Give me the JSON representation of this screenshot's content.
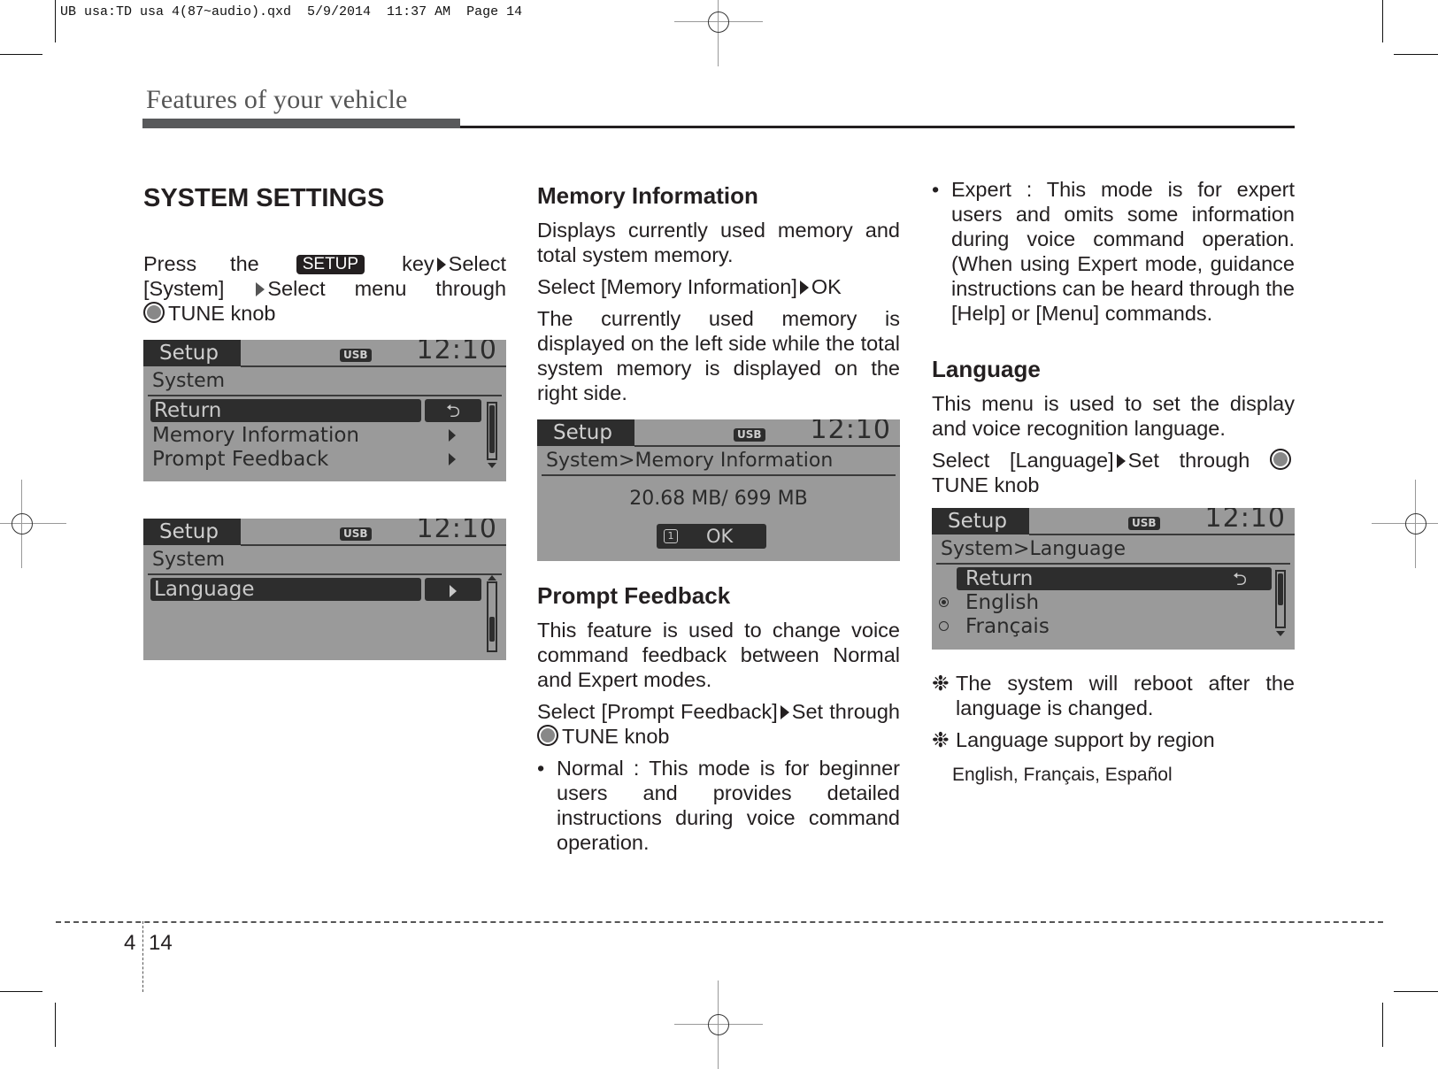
{
  "slug_line": "UB usa:TD usa 4(87~audio).qxd  5/9/2014  11:37 AM  Page 14",
  "running_head": "Features of your vehicle",
  "icons": {
    "arrow": "triangle-right-icon",
    "knob": "tune-knob-icon",
    "return": "return-arrow-icon",
    "note": "asterisk-note-icon"
  },
  "section1": {
    "title": "SYSTEM SETTINGS",
    "intro": {
      "t1": "Press the",
      "key": "SETUP",
      "t2": "key",
      "t3": "Select [System]",
      "t4": "Select menu through",
      "t5": "TUNE knob"
    },
    "screen1": {
      "tab": "Setup",
      "usb": "USB",
      "clock": "12:10",
      "path": "System",
      "rows": [
        "Return",
        "Memory Information",
        "Prompt Feedback"
      ],
      "scroll_position": 0
    },
    "screen2": {
      "tab": "Setup",
      "usb": "USB",
      "clock": "12:10",
      "path": "System",
      "rows": [
        "Language"
      ],
      "scroll_position": 1
    }
  },
  "section2": {
    "title": "Memory Information",
    "p1": "Displays currently used memory and total system memory.",
    "p2a": "Select [Memory Information]",
    "p2b": "OK",
    "p3": "The currently used memory is displayed on the left side while the total system memory is displayed on the right side.",
    "screen": {
      "tab": "Setup",
      "usb": "USB",
      "clock": "12:10",
      "path": "System>Memory Information",
      "memory": "20.68 MB/ 699 MB",
      "ok_num": "1",
      "ok": "OK"
    }
  },
  "section3": {
    "title": "Prompt Feedback",
    "p1": "This feature is used to change voice command feedback between Normal and Expert modes.",
    "p2a": "Select [Prompt Feedback]",
    "p2b": "Set through",
    "p2c": "TUNE knob",
    "bullets": [
      "Normal : This mode is for beginner users and provides detailed instructions during voice command operation.",
      "Expert : This mode is for expert users and omits some information during voice command operation. (When using Expert mode, guidance instructions can be heard through the [Help] or [Menu] commands."
    ]
  },
  "section4": {
    "title": "Language",
    "p1": "This menu is used to set the display and voice recognition language.",
    "p2a": "Select [Language]",
    "p2b": "Set through",
    "p2c": "TUNE knob",
    "screen": {
      "tab": "Setup",
      "usb": "USB",
      "clock": "12:10",
      "path": "System>Language",
      "return": "Return",
      "options": [
        {
          "label": "English",
          "selected": true
        },
        {
          "label": "Français",
          "selected": false
        }
      ]
    },
    "note1": "The system will reboot after the language is changed.",
    "note2": "Language support by region",
    "languages": "English, Français, Español"
  },
  "footer": {
    "chapter": "4",
    "page": "14"
  }
}
